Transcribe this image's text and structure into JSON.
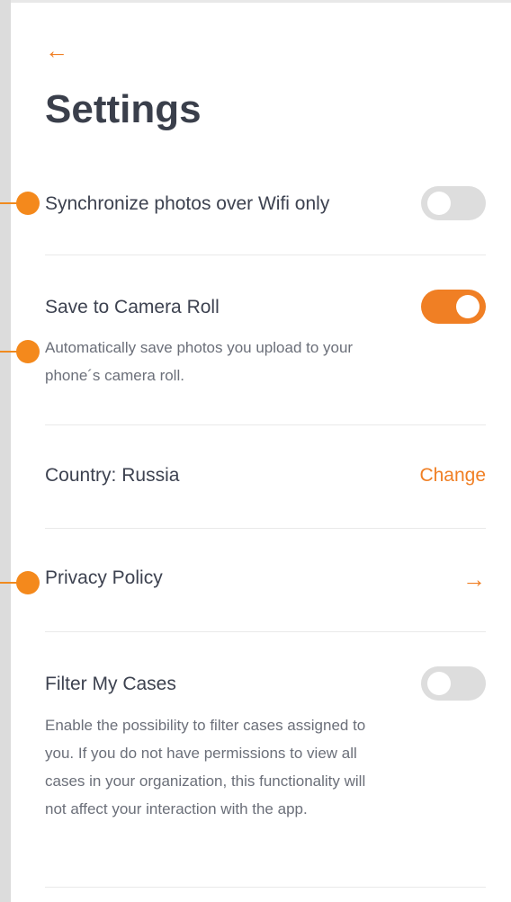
{
  "header": {
    "back_icon": "arrow-left-icon",
    "title": "Settings"
  },
  "settings": {
    "wifi_sync": {
      "label": "Synchronize photos over Wifi only",
      "enabled": false
    },
    "camera_roll": {
      "label": "Save to Camera Roll",
      "description": "Automatically save photos you upload to your phone´s camera roll.",
      "enabled": true
    },
    "country": {
      "label": "Country:",
      "value": "Russia",
      "action": "Change"
    },
    "privacy": {
      "label": "Privacy Policy",
      "icon": "arrow-right-icon"
    },
    "filter_cases": {
      "label": "Filter My Cases",
      "description": "Enable the possibility to filter cases assigned to you. If you do not have permissions to view all cases in your organization, this functionality will not affect your interaction with the app.",
      "enabled": false
    }
  },
  "colors": {
    "accent": "#f07f24",
    "toggle_off": "#dddddd",
    "title": "#3a3f4b",
    "marker": "#f4891c"
  }
}
